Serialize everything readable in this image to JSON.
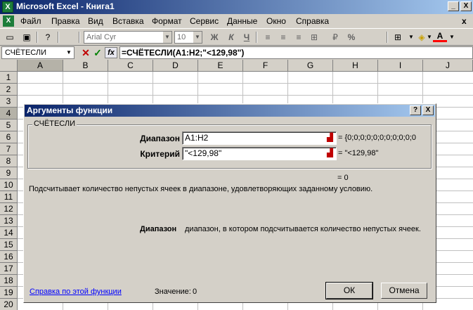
{
  "window": {
    "title": "Microsoft Excel - Книга1",
    "minimize": "_",
    "close": "X"
  },
  "menu": [
    "Файл",
    "Правка",
    "Вид",
    "Вставка",
    "Формат",
    "Сервис",
    "Данные",
    "Окно",
    "Справка"
  ],
  "menu_close": "x",
  "toolbar": {
    "font_name": "Arial Cyr",
    "font_size": "10",
    "bold": "Ж",
    "italic": "К",
    "underline": "Ч",
    "percent": "%"
  },
  "formula_bar": {
    "name_box": "СЧЁТЕСЛИ",
    "formula": "=СЧЁТЕСЛИ(A1:H2;\"<129,98\")"
  },
  "columns": [
    "A",
    "B",
    "C",
    "D",
    "E",
    "F",
    "G",
    "H",
    "I",
    "J"
  ],
  "rows": [
    "1",
    "2",
    "3",
    "4",
    "5",
    "6",
    "7",
    "8",
    "9",
    "10",
    "11",
    "12",
    "13",
    "14",
    "15",
    "16",
    "17",
    "18",
    "19",
    "20"
  ],
  "dialog": {
    "title": "Аргументы функции",
    "help": "?",
    "close": "X",
    "function_name": "СЧЁТЕСЛИ",
    "args": [
      {
        "label": "Диапазон",
        "value": "A1:H2",
        "result": "= {0;0;0;0;0;0;0;0;0;0;0"
      },
      {
        "label": "Критерий",
        "value": "\"<129,98\"",
        "result": "= \"<129,98\""
      }
    ],
    "total": "= 0",
    "description": "Подсчитывает количество непустых ячеек в диапазоне, удовлетворяющих заданному условию.",
    "arg_help_name": "Диапазон",
    "arg_help_text": "диапазон, в котором подсчитывается количество непустых ячеек.",
    "help_link": "Справка по этой функции",
    "value_label": "Значение:",
    "value": "0",
    "ok": "ОК",
    "cancel": "Отмена"
  }
}
